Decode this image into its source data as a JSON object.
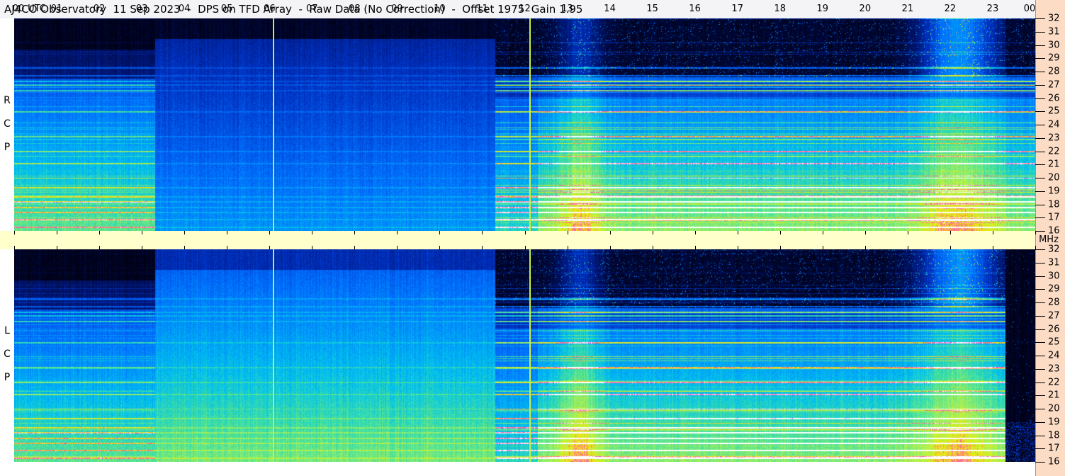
{
  "title": "AJ4CO Observatory  11 Sep 2023  -  DPS on TFD Array  -  Raw Data (No Correction)  -  Offset 1975  Gain 1.95",
  "panels": [
    {
      "label_letters": [
        "R",
        "C",
        "P"
      ],
      "name": "RCP"
    },
    {
      "label_letters": [
        "L",
        "C",
        "P"
      ],
      "name": "LCP"
    }
  ],
  "chart_data": {
    "type": "heatmap",
    "title": "AJ4CO Observatory 11 Sep 2023 - DPS on TFD Array - Raw Data (No Correction) - Offset 1975 Gain 1.95",
    "xlabel": "UTC",
    "ylabel": "MHz",
    "x_ticks": [
      "00",
      "01",
      "02",
      "03",
      "04",
      "05",
      "06",
      "07",
      "08",
      "09",
      "10",
      "11",
      "12",
      "13",
      "14",
      "15",
      "16",
      "17",
      "18",
      "19",
      "20",
      "21",
      "22",
      "23",
      "00"
    ],
    "x_range_hours": [
      0,
      24
    ],
    "y_ticks": [
      16,
      17,
      18,
      19,
      20,
      21,
      22,
      23,
      24,
      25,
      26,
      27,
      28,
      29,
      30,
      31,
      32
    ],
    "y_range_mhz": [
      16,
      32
    ],
    "x_unit_label": "UTC",
    "y_unit_label": "MHz",
    "marker_lines_hours": [
      6.08,
      12.1
    ],
    "interference_mhz": [
      16.3,
      16.9,
      17.4,
      17.8,
      18.2,
      18.6,
      19.3,
      20.0,
      21.1,
      22.0,
      23.1,
      25.0,
      26.6,
      27.0,
      27.3,
      27.7,
      28.3
    ]
  },
  "colors": {
    "title_bg": "#f4f4f7",
    "time_axis_bg": "#ffffcc",
    "freq_axis_bg": "#fcdcc4",
    "marker": "#c8f040"
  }
}
